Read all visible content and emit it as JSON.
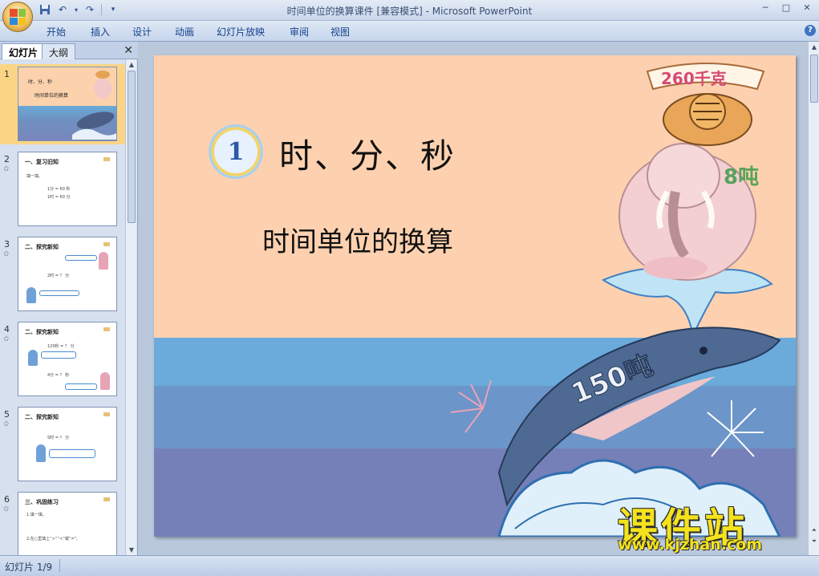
{
  "window": {
    "title": "时间单位的换算课件 [兼容模式] - Microsoft PowerPoint",
    "controls": [
      "─",
      "□",
      "✕"
    ]
  },
  "ribbon": {
    "tabs": [
      "开始",
      "插入",
      "设计",
      "动画",
      "幻灯片放映",
      "审阅",
      "视图"
    ],
    "help": "?"
  },
  "left_pane": {
    "tabs": [
      "幻灯片",
      "大纲"
    ],
    "close": "✕",
    "slides": [
      {
        "num": "1",
        "star": "",
        "title": "时、分、秒",
        "lines": [
          "时间单位的换算"
        ]
      },
      {
        "num": "2",
        "star": "✩",
        "title": "一、复习旧知",
        "lines": [
          "填一填。",
          "1分 = 60 秒",
          "1时 = 60 分"
        ]
      },
      {
        "num": "3",
        "star": "✩",
        "title": "二、探究新知",
        "lines": [
          "2时 = ？ 分"
        ]
      },
      {
        "num": "4",
        "star": "✩",
        "title": "二、探究新知",
        "lines": [
          "120秒 = ？ 分",
          "4分 = ？ 秒"
        ]
      },
      {
        "num": "5",
        "star": "✩",
        "title": "二、探究新知",
        "lines": [
          "5时 = ？ 分"
        ]
      },
      {
        "num": "6",
        "star": "✩",
        "title": "三、巩固练习",
        "lines": [
          "1.填一填。",
          "2.在○里填上“>”“<”或“=”。"
        ]
      }
    ]
  },
  "slide": {
    "badge_number": "1",
    "title": "时、分、秒",
    "subtitle": "时间单位的换算",
    "art_labels": {
      "tiger_banner": "260千克",
      "elephant": "8吨",
      "whale": "150吨"
    }
  },
  "watermark": {
    "main": "课件站",
    "url": "www.kjzhan.com"
  },
  "status": {
    "slide_indicator": "幻灯片 1/9"
  },
  "colors": {
    "slide_bg": "#fdd1af",
    "sea_top": "#6aabdc",
    "sea_mid": "#6c95c9",
    "sea_bottom": "#7580b8",
    "selected_thumb": "#fbd585",
    "watermark": "#f4e31c"
  }
}
